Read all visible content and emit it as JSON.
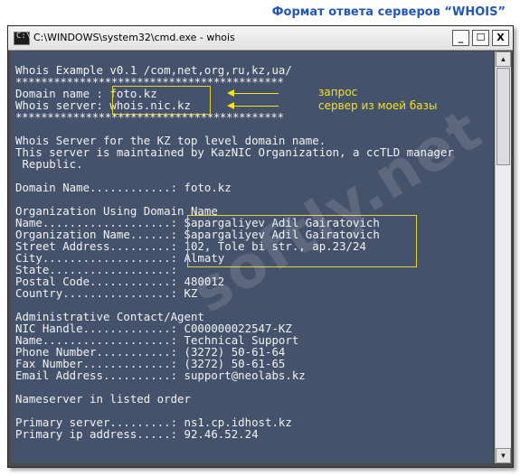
{
  "heading": "Формат ответа серверов “WHOIS”",
  "window": {
    "title": "C:\\WINDOWS\\system32\\cmd.exe - whois",
    "min_glyph": "_",
    "max_glyph": "☐",
    "close_glyph": "X"
  },
  "console": {
    "lines": [
      "Whois Example v0.1 /com,net,org,ru,kz,ua/",
      "******************************************",
      "Domain name : foto.kz",
      "Whois server: whois.nic.kz",
      "******************************************",
      "",
      "Whois Server for the KZ top level domain name.",
      "This server is maintained by KazNIC Organization, a ccTLD manager",
      " Republic.",
      "",
      "Domain Name............: foto.kz",
      "",
      "Organization Using Domain Name",
      "Name...................: Sapargaliyev Adil Gairatovich",
      "Organization Name......: Sapargaliyev Adil Gairatovich",
      "Street Address.........: 102, Tole bi str., ap.23/24",
      "City...................: Almaty",
      "State..................:",
      "Postal Code............: 480012",
      "Country................: KZ",
      "",
      "Administrative Contact/Agent",
      "NIC Handle.............: C000000022547-KZ",
      "Name...................: Technical Support",
      "Phone Number...........: (3272) 50-61-64",
      "Fax Number.............: (3272) 50-61-65",
      "Email Address..........: support@neolabs.kz",
      "",
      "Nameserver in listed order",
      "",
      "Primary server.........: ns1.cp.idhost.kz",
      "Primary ip address.....: 92.46.52.24"
    ]
  },
  "annotations": {
    "request": "запрос",
    "server": "сервер из моей базы"
  },
  "watermark": "softly.net",
  "colors": {
    "heading": "#1f58b8",
    "console_bg": "#45526b",
    "highlight": "#f4e21a"
  }
}
